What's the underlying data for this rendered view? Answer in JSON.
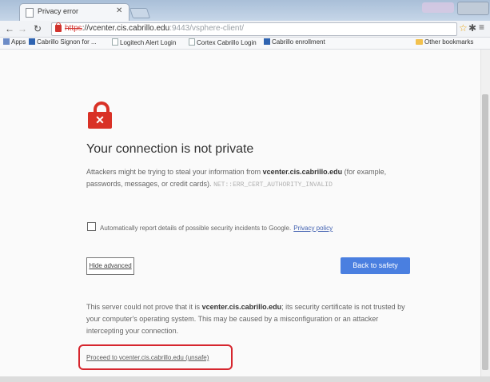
{
  "tab": {
    "title": "Privacy error"
  },
  "toolbar": {
    "url_scheme": "https",
    "url_host": "://vcenter.cis.cabrillo.edu",
    "url_path": ":9443/vsphere-client/"
  },
  "bookmarks": [
    {
      "label": "Apps",
      "icon": "grid"
    },
    {
      "label": "Cabrillo Signon for ...",
      "icon": "blue"
    },
    {
      "label": "Logitech Alert Login",
      "icon": "page"
    },
    {
      "label": "Cortex Cabrillo Login",
      "icon": "page"
    },
    {
      "label": "Cabrillo enrollment",
      "icon": "blue"
    }
  ],
  "other_bookmarks": "Other bookmarks",
  "page": {
    "heading": "Your connection is not private",
    "desc_pre": "Attackers might be trying to steal your information from ",
    "host": "vcenter.cis.cabrillo.edu",
    "desc_post": " (for example, passwords, messages, or credit cards). ",
    "error_code": "NET::ERR_CERT_AUTHORITY_INVALID",
    "checkbox_label": "Automatically report details of possible security incidents to Google.",
    "privacy_link": "Privacy policy",
    "hide_advanced": "Hide advanced",
    "back_to_safety": "Back to safety",
    "details_pre": "This server could not prove that it is ",
    "details_post": "; its security certificate is not trusted by your computer's operating system. This may be caused by a misconfiguration or an attacker intercepting your connection.",
    "proceed_link": "Proceed to vcenter.cis.cabrillo.edu (unsafe)"
  },
  "colors": {
    "danger_red": "#d93126",
    "primary_blue": "#4a7fe0",
    "annotation_red": "#d6262e"
  }
}
